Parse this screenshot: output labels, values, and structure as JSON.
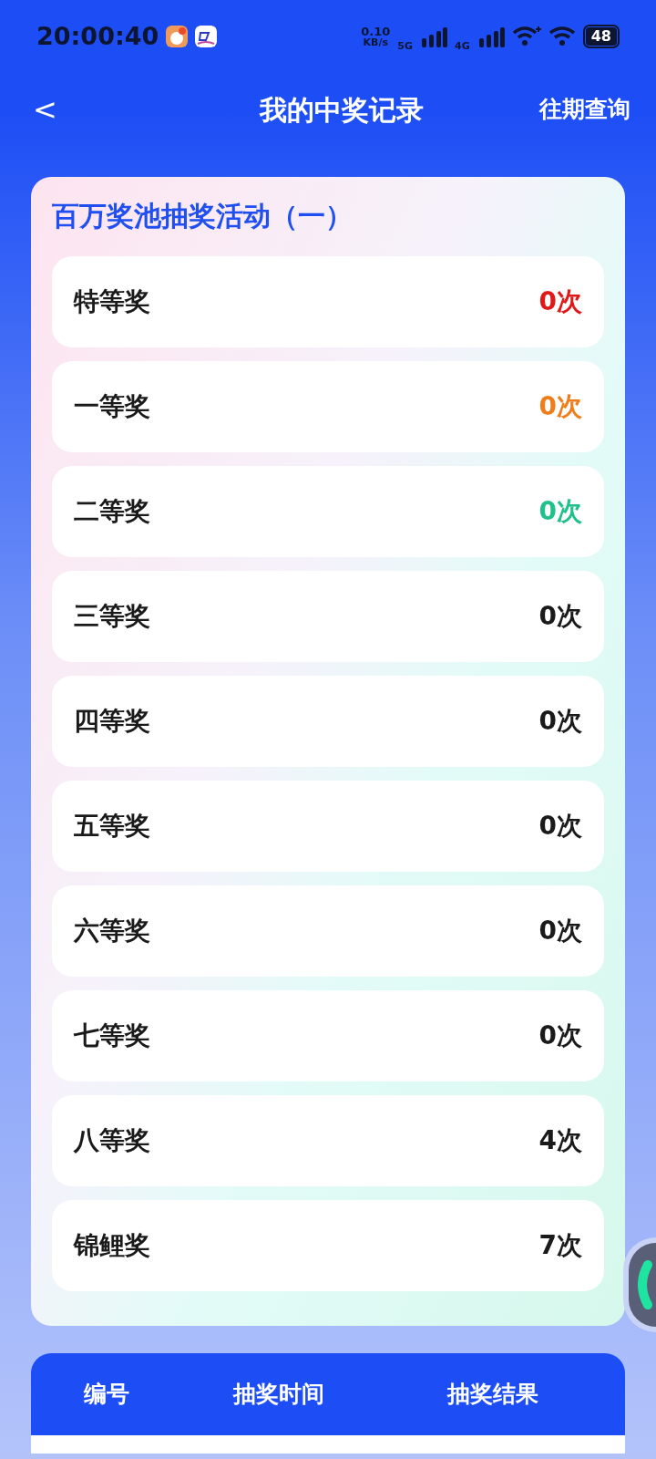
{
  "status_bar": {
    "time": "20:00:40",
    "net_speed": "0.10",
    "net_unit": "KB/s",
    "sim1": "5G",
    "sim2": "4G",
    "battery": "48"
  },
  "header": {
    "back": "<",
    "title": "我的中奖记录",
    "action": "往期查询"
  },
  "activity": {
    "title": "百万奖池抽奖活动（一）",
    "prizes": [
      {
        "name": "特等奖",
        "count": "0次",
        "color": "#e01818"
      },
      {
        "name": "一等奖",
        "count": "0次",
        "color": "#ef7d1a"
      },
      {
        "name": "二等奖",
        "count": "0次",
        "color": "#1fc08a"
      },
      {
        "name": "三等奖",
        "count": "0次",
        "color": "#1a1a1a"
      },
      {
        "name": "四等奖",
        "count": "0次",
        "color": "#1a1a1a"
      },
      {
        "name": "五等奖",
        "count": "0次",
        "color": "#1a1a1a"
      },
      {
        "name": "六等奖",
        "count": "0次",
        "color": "#1a1a1a"
      },
      {
        "name": "七等奖",
        "count": "0次",
        "color": "#1a1a1a"
      },
      {
        "name": "八等奖",
        "count": "4次",
        "color": "#1a1a1a"
      },
      {
        "name": "锦鲤奖",
        "count": "7次",
        "color": "#1a1a1a"
      }
    ]
  },
  "table": {
    "columns": [
      "编号",
      "抽奖时间",
      "抽奖结果"
    ]
  }
}
